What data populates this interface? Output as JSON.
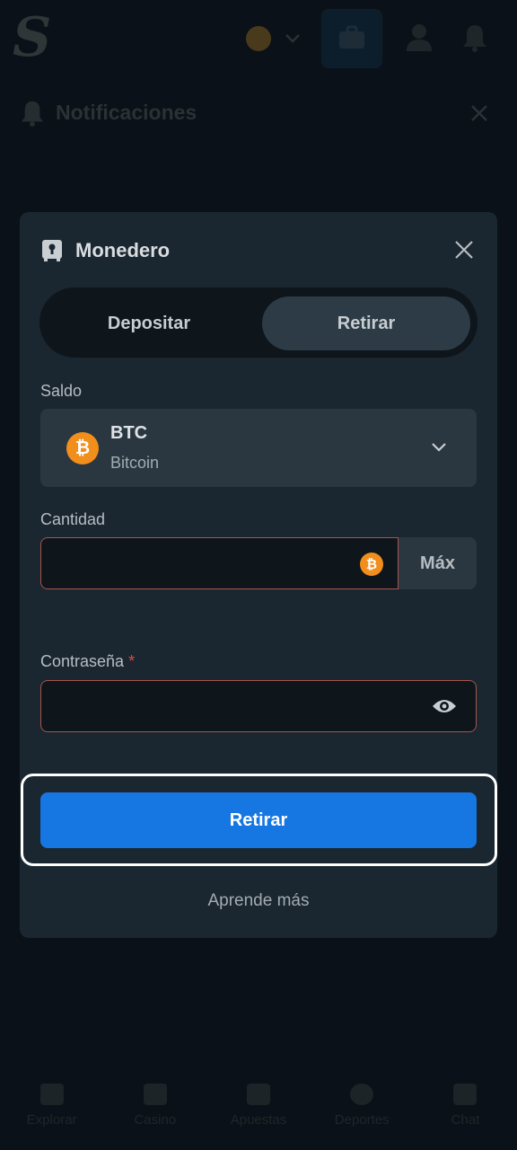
{
  "app": {
    "logo_text": "S"
  },
  "notifications": {
    "title": "Notificaciones"
  },
  "bottom_nav": {
    "items": [
      {
        "label": "Explorar",
        "icon": "search-list-icon"
      },
      {
        "label": "Casino",
        "icon": "cards-icon"
      },
      {
        "label": "Apuestas",
        "icon": "ticket-icon"
      },
      {
        "label": "Deportes",
        "icon": "ball-icon"
      },
      {
        "label": "Chat",
        "icon": "chat-icon"
      }
    ]
  },
  "wallet": {
    "title": "Monedero",
    "tabs": {
      "deposit": "Depositar",
      "withdraw": "Retirar",
      "active": "withdraw"
    },
    "balance_label": "Saldo",
    "currency": {
      "code": "BTC",
      "name": "Bitcoin",
      "symbol": "₿"
    },
    "amount_label": "Cantidad",
    "max_label": "Máx",
    "password_label": "Contraseña",
    "required_mark": "*",
    "submit_label": "Retirar",
    "learn_more": "Aprende más"
  },
  "colors": {
    "accent": "#1676e2",
    "modal_bg": "#1a2630",
    "error_border": "#a8544e",
    "btc": "#f18e1c"
  }
}
